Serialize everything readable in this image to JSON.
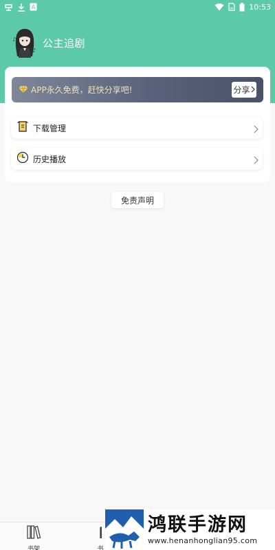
{
  "status_bar": {
    "time": "10:53",
    "left_icons": [
      "bug-icon",
      "download-icon",
      "text-a-icon"
    ],
    "right_icons": [
      "wifi-icon",
      "sim-icon",
      "battery-icon"
    ]
  },
  "profile": {
    "name": "公主追剧"
  },
  "banner": {
    "text": "APP永久免费，赶快分享吧!",
    "share_label": "分享"
  },
  "menu": [
    {
      "label": "下载管理",
      "icon": "download-shirt-icon"
    },
    {
      "label": "历史播放",
      "icon": "clock-icon"
    }
  ],
  "disclaimer_label": "免责声明",
  "bottom_nav": [
    {
      "label": "书架",
      "icon": "bookshelf-icon"
    },
    {
      "label": "书",
      "icon": "book-icon"
    }
  ],
  "watermark": {
    "title": "鸿联手游网",
    "url": "www.henanhonglian95.com"
  },
  "colors": {
    "accent": "#5ccaa9",
    "banner_text": "#f2e2b6"
  }
}
